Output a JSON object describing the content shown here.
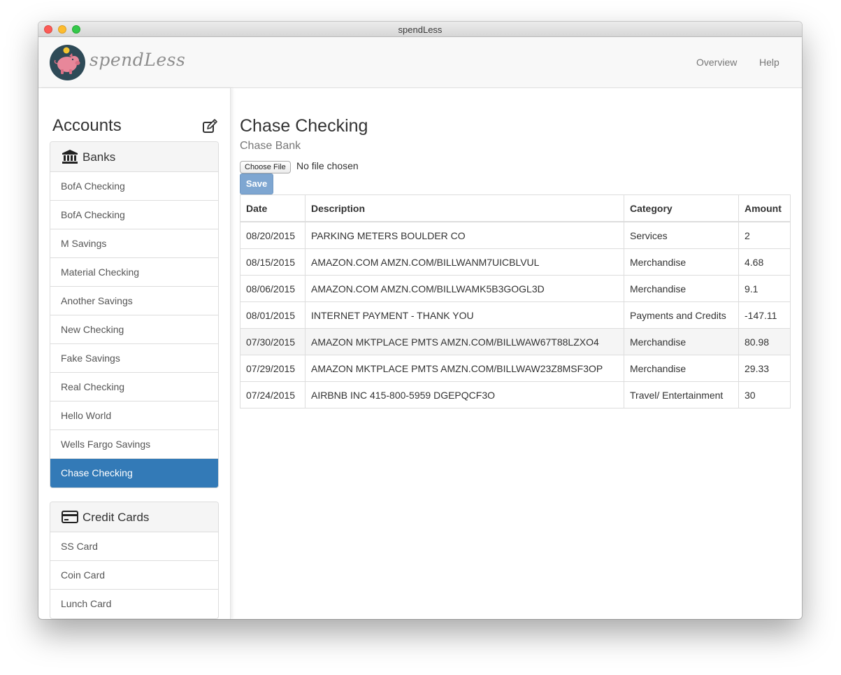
{
  "window": {
    "title": "spendLess"
  },
  "navbar": {
    "logo_text": "spendLess",
    "links": [
      "Overview",
      "Help"
    ]
  },
  "sidebar": {
    "heading": "Accounts",
    "banks": {
      "label": "Banks",
      "items": [
        "BofA Checking",
        "BofA Checking",
        "M Savings",
        "Material Checking",
        "Another Savings",
        "New Checking",
        "Fake Savings",
        "Real Checking",
        "Hello World",
        "Wells Fargo Savings",
        "Chase Checking"
      ],
      "active_item": "Chase Checking"
    },
    "credit_cards": {
      "label": "Credit Cards",
      "items": [
        "SS Card",
        "Coin Card",
        "Lunch Card"
      ]
    }
  },
  "main": {
    "title": "Chase Checking",
    "subtitle": "Chase Bank",
    "file_button": "Choose File",
    "file_status": "No file chosen",
    "save_label": "Save",
    "table": {
      "headers": [
        "Date",
        "Description",
        "Category",
        "Amount"
      ],
      "rows": [
        [
          "08/20/2015",
          "PARKING METERS BOULDER CO",
          "Services",
          "2"
        ],
        [
          "08/15/2015",
          "AMAZON.COM AMZN.COM/BILLWANM7UICBLVUL",
          "Merchandise",
          "4.68"
        ],
        [
          "08/06/2015",
          "AMAZON.COM AMZN.COM/BILLWAMK5B3GOGL3D",
          "Merchandise",
          "9.1"
        ],
        [
          "08/01/2015",
          "INTERNET PAYMENT - THANK YOU",
          "Payments and Credits",
          "-147.11"
        ],
        [
          "07/30/2015",
          "AMAZON MKTPLACE PMTS AMZN.COM/BILLWAW67T88LZXO4",
          "Merchandise",
          "80.98"
        ],
        [
          "07/29/2015",
          "AMAZON MKTPLACE PMTS AMZN.COM/BILLWAW23Z8MSF3OP",
          "Merchandise",
          "29.33"
        ],
        [
          "07/24/2015",
          "AIRBNB INC 415-800-5959 DGEPQCF3O",
          "Travel/ Entertainment",
          "30"
        ]
      ],
      "highlighted_row": 4
    }
  },
  "colors": {
    "accent": "#337ab7",
    "save_button": "#7ea6d1",
    "logo_background": "#2e4a57",
    "piggy": "#e8879a"
  },
  "icons": {
    "edit": "edit-icon",
    "banks": "bank-icon",
    "credit_cards": "credit-card-icon",
    "logo": "piggy-bank-icon"
  }
}
